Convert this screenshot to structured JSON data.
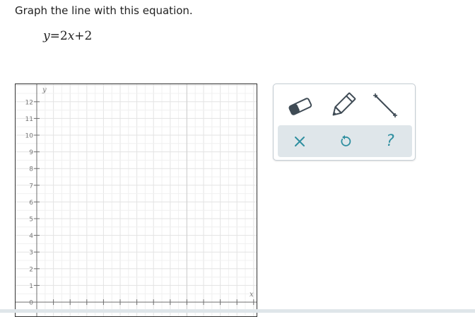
{
  "question": {
    "prompt": "Graph the line with this equation.",
    "equation": {
      "lhs": "y",
      "equals": "=",
      "coefficient": "2",
      "variable": "x",
      "plus": "+",
      "constant": "2"
    }
  },
  "graph": {
    "x_axis_label": "x",
    "y_axis_label": "y",
    "y_ticks": [
      "12",
      "11",
      "10",
      "9",
      "8",
      "7",
      "6",
      "5",
      "4",
      "3",
      "2",
      "1",
      "0"
    ],
    "grid_color": "#e3e3e3",
    "axis_color": "#6f6f6f"
  },
  "toolbar": {
    "tools": [
      {
        "name": "eraser-tool",
        "icon": "eraser-icon"
      },
      {
        "name": "pencil-tool",
        "icon": "pencil-icon"
      },
      {
        "name": "line-tool",
        "icon": "line-segment-icon"
      }
    ],
    "actions": [
      {
        "name": "clear-button",
        "icon": "close-icon"
      },
      {
        "name": "undo-button",
        "icon": "undo-icon"
      },
      {
        "name": "help-button",
        "icon": "help-icon",
        "glyph": "?"
      }
    ],
    "accent_color": "#2f8fa0",
    "icon_color": "#3f4b55"
  }
}
